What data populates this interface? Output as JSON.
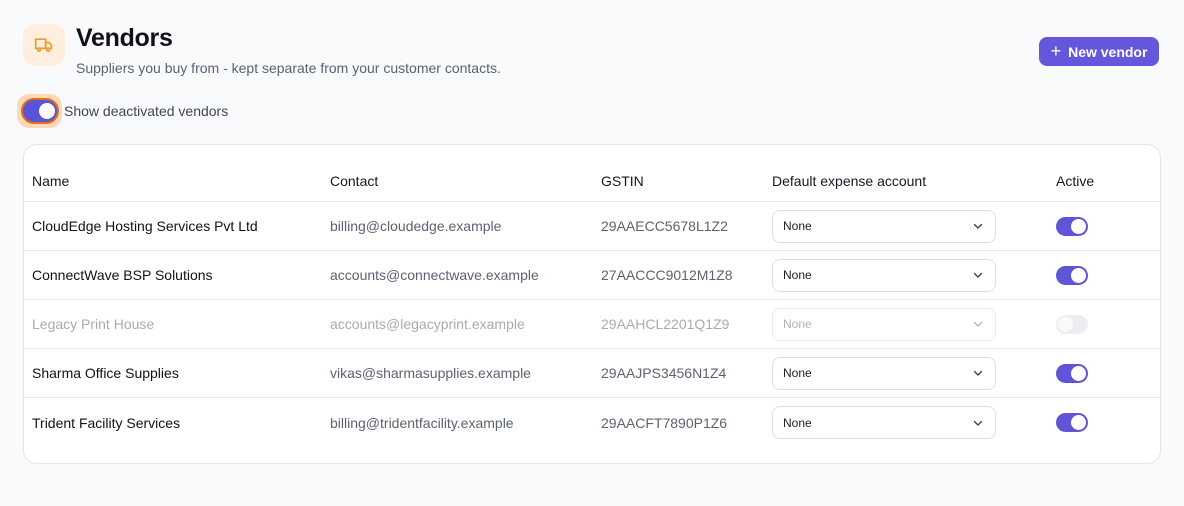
{
  "header": {
    "icon": "truck-icon",
    "title": "Vendors",
    "subtitle": "Suppliers you buy from - kept separate from your customer contacts.",
    "new_button_label": "New vendor"
  },
  "filters": {
    "show_deactivated_label": "Show deactivated vendors",
    "show_deactivated_on": true
  },
  "table": {
    "columns": {
      "name": "Name",
      "contact": "Contact",
      "gstin": "GSTIN",
      "account": "Default expense account",
      "active": "Active"
    },
    "rows": [
      {
        "name": "CloudEdge Hosting Services Pvt Ltd",
        "contact": "billing@cloudedge.example",
        "gstin": "29AAECC5678L1Z2",
        "account": "None",
        "active": true
      },
      {
        "name": "ConnectWave BSP Solutions",
        "contact": "accounts@connectwave.example",
        "gstin": "27AACCC9012M1Z8",
        "account": "None",
        "active": true
      },
      {
        "name": "Legacy Print House",
        "contact": "accounts@legacyprint.example",
        "gstin": "29AAHCL2201Q1Z9",
        "account": "None",
        "active": false
      },
      {
        "name": "Sharma Office Supplies",
        "contact": "vikas@sharmasupplies.example",
        "gstin": "29AAJPS3456N1Z4",
        "account": "None",
        "active": true
      },
      {
        "name": "Trident Facility Services",
        "contact": "billing@tridentfacility.example",
        "gstin": "29AACFT7890P1Z6",
        "account": "None",
        "active": true
      }
    ]
  },
  "colors": {
    "accent": "#6457db",
    "focus_ring": "#e46f12",
    "icon_bg": "#fdeedd",
    "icon_stroke": "#ef9b26"
  }
}
